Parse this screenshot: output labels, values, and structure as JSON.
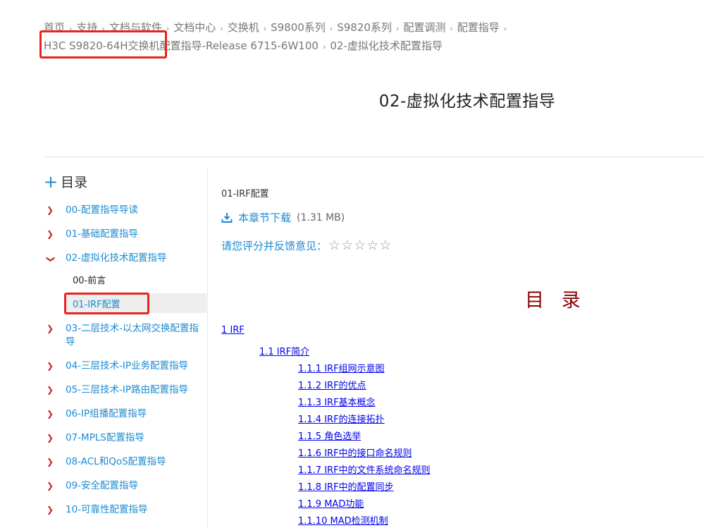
{
  "breadcrumb": {
    "items": [
      "首页",
      "支持",
      "文档与软件",
      "文档中心",
      "交换机",
      "S9800系列",
      "S9820系列",
      "配置调测",
      "配置指导"
    ],
    "line2_highlight": "H3C S9820-64H交换机",
    "line2_rest": "配置指导-Release 6715-6W100",
    "current": "02-虚拟化技术配置指导",
    "separator": "›"
  },
  "page": {
    "title": "02-虚拟化技术配置指导"
  },
  "sidebar": {
    "header": "目录",
    "items": [
      {
        "label": "00-配置指导导读"
      },
      {
        "label": "01-基础配置指导"
      },
      {
        "label": "02-虚拟化技术配置指导"
      },
      {
        "label": "03-二层技术-以太网交换配置指导"
      },
      {
        "label": "04-三层技术-IP业务配置指导"
      },
      {
        "label": "05-三层技术-IP路由配置指导"
      },
      {
        "label": "06-IP组播配置指导"
      },
      {
        "label": "07-MPLS配置指导"
      },
      {
        "label": "08-ACL和QoS配置指导"
      },
      {
        "label": "09-安全配置指导"
      },
      {
        "label": "10-可靠性配置指导"
      }
    ],
    "sub_items": [
      {
        "label": "00-前言"
      },
      {
        "label": "01-IRF配置"
      }
    ]
  },
  "main": {
    "chapter": "01-IRF配置",
    "download_label": "本章节下载",
    "download_size": "(1.31 MB)",
    "rating_label": "请您评分并反馈意见：",
    "star_count": 5,
    "toc_title": "目 录",
    "toc_links": [
      {
        "label": "1 IRF"
      },
      {
        "label": "1.1 IRF简介"
      },
      {
        "label": "1.1.1 IRF组网示意图"
      },
      {
        "label": "1.1.2 IRF的优点"
      },
      {
        "label": "1.1.3 IRF基本概念"
      },
      {
        "label": "1.1.4 IRF的连接拓扑"
      },
      {
        "label": "1.1.5 角色选举"
      },
      {
        "label": "1.1.6 IRF中的接口命名规则"
      },
      {
        "label": "1.1.7 IRF中的文件系统命名规则"
      },
      {
        "label": "1.1.8 IRF中的配置同步"
      },
      {
        "label": "1.1.9 MAD功能"
      },
      {
        "label": "1.1.10 MAD检测机制"
      }
    ]
  },
  "colors": {
    "link_blue": "#1a8bd1",
    "doc_link": "#0000ee",
    "chevron_red": "#c1272d",
    "highlight_red": "#e8231f",
    "toc_title": "#8b0000"
  }
}
